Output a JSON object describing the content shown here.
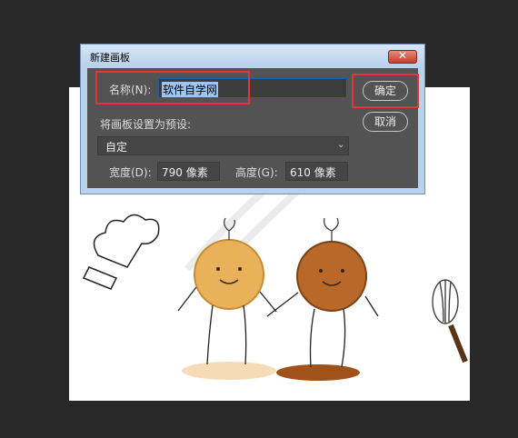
{
  "dialog": {
    "title": "新建画板",
    "close_label": "✕",
    "name_label": "名称(N):",
    "name_value": "软件自学网",
    "ok_label": "确定",
    "cancel_label": "取消",
    "preset_label": "将画板设置为预设:",
    "preset_value": "自定",
    "width_label": "宽度(D):",
    "width_value": "790 像素",
    "height_label": "高度(G):",
    "height_value": "610 像素"
  },
  "icons": {
    "chevron": "chevron-down-icon",
    "close": "close-icon"
  },
  "colors": {
    "highlight_box": "#e8323c",
    "dialog_frame": "#b9d1ea",
    "client_bg": "#535353"
  }
}
